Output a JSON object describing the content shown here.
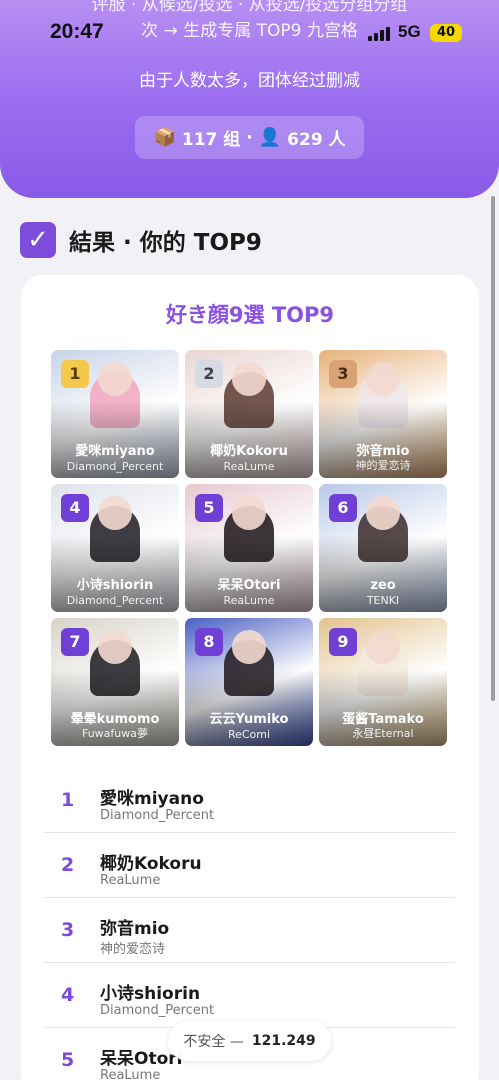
{
  "status_bar": {
    "time": "20:47",
    "network": "5G",
    "battery": "40"
  },
  "hero": {
    "line1": "评服 · 从候选/投选 · 从投选/投选分组分组",
    "line2": "次 → 生成专属 TOP9 九宫格",
    "note": "由于人数太多，团体经过删减",
    "stats": {
      "groups_icon": "package-icon",
      "groups": "117 组",
      "sep": "·",
      "people_icon": "person-icon",
      "people": "629 人"
    }
  },
  "section": {
    "title": "結果 · 你的 TOP9"
  },
  "card": {
    "title": "好き顔9選 TOP9"
  },
  "top9": [
    {
      "rank": "1",
      "name": "愛咪miyano",
      "group": "Diamond_Percent",
      "badge": "gold",
      "bg": "#c9d4e8",
      "accent": "#f2a6c0"
    },
    {
      "rank": "2",
      "name": "椰奶Kokoru",
      "group": "ReaLume",
      "badge": "silver",
      "bg": "#e9d6d2",
      "accent": "#5a3a30"
    },
    {
      "rank": "3",
      "name": "弥音mio",
      "group": "神的爱恋诗",
      "badge": "bronze",
      "bg": "#e8b27a",
      "accent": "#efe6ea"
    },
    {
      "rank": "4",
      "name": "小诗shiorin",
      "group": "Diamond_Percent",
      "badge": "purple",
      "bg": "#dfe3ea",
      "accent": "#1f1b22"
    },
    {
      "rank": "5",
      "name": "呆呆Otori",
      "group": "ReaLume",
      "badge": "purple",
      "bg": "#e6c9cf",
      "accent": "#1b1418"
    },
    {
      "rank": "6",
      "name": "zeo",
      "group": "TENKI",
      "badge": "purple",
      "bg": "#b9c9e8",
      "accent": "#3a2a2a"
    },
    {
      "rank": "7",
      "name": "晕晕kumomo",
      "group": "Fuwafuwa夢",
      "badge": "purple",
      "bg": "#d6d3c8",
      "accent": "#1b1a1e"
    },
    {
      "rank": "8",
      "name": "云云Yumiko",
      "group": "ReComi",
      "badge": "purple",
      "bg": "#4a5fc4",
      "accent": "#20181c"
    },
    {
      "rank": "9",
      "name": "蛋酱Tamako",
      "group": "永昼Eternal",
      "badge": "purple",
      "bg": "#e3c28e",
      "accent": "#f4eadd"
    }
  ],
  "list": [
    {
      "rank": "1",
      "name": "愛咪miyano",
      "group": "Diamond_Percent"
    },
    {
      "rank": "2",
      "name": "椰奶Kokoru",
      "group": "ReaLume"
    },
    {
      "rank": "3",
      "name": "弥音mio",
      "group": "神的爱恋诗"
    },
    {
      "rank": "4",
      "name": "小诗shiorin",
      "group": "Diamond_Percent"
    },
    {
      "rank": "5",
      "name": "呆呆Otori",
      "group": "ReaLume"
    }
  ],
  "url_bar": {
    "insecure": "不安全 —",
    "address": "121.249"
  },
  "colors": {
    "accent": "#7d4cdb",
    "hero_top": "#b78ff2",
    "hero_bottom": "#8a5ae8"
  }
}
